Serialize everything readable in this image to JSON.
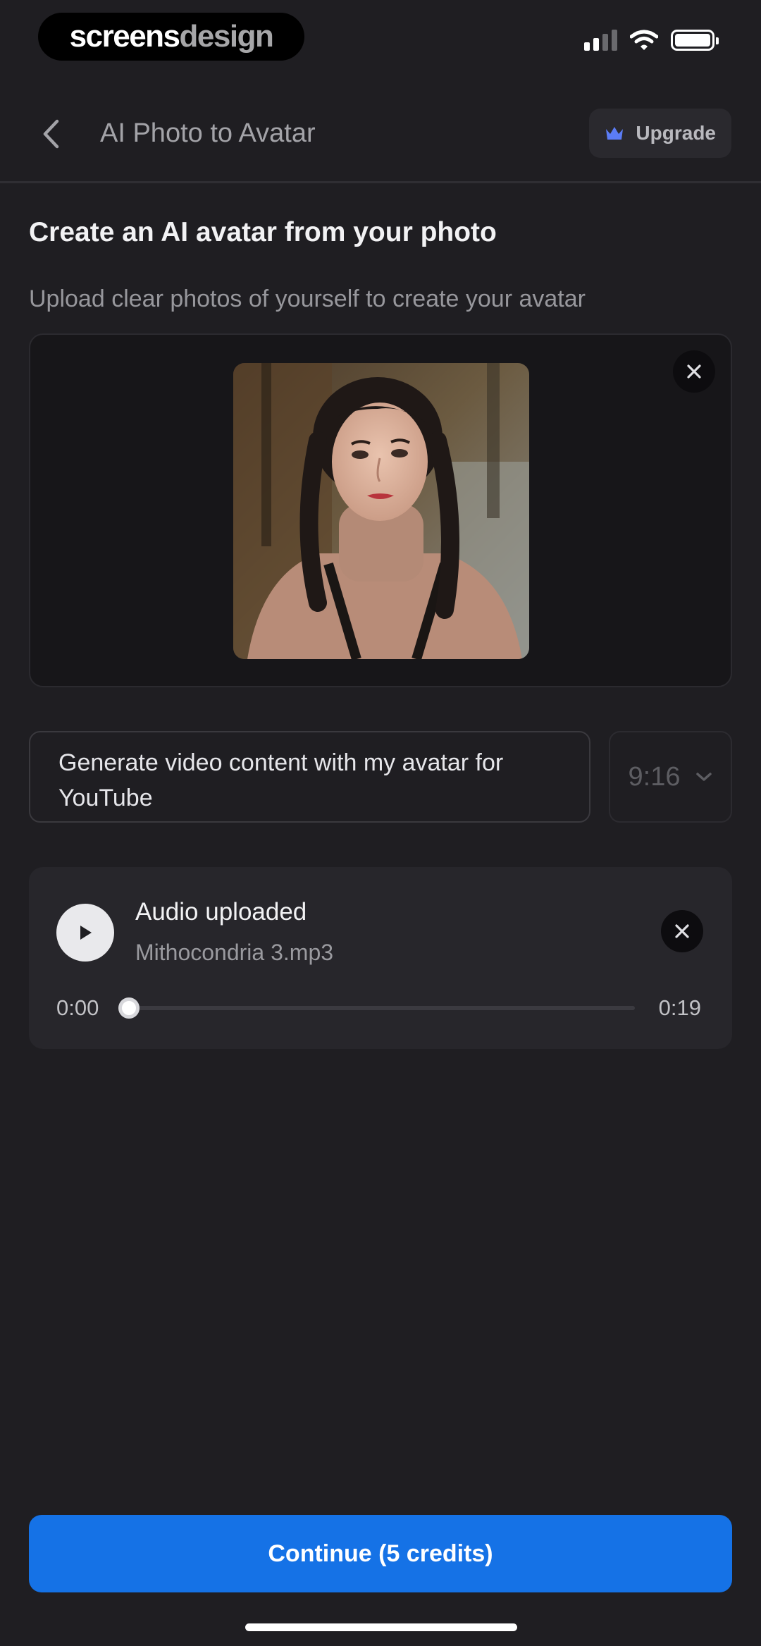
{
  "status_bar": {
    "brand_part1": "screens",
    "brand_part2": "design",
    "signal_icon": "cellular-signal-icon",
    "wifi_icon": "wifi-icon",
    "battery_icon": "battery-icon"
  },
  "header": {
    "back_icon": "chevron-left-icon",
    "title": "AI Photo to Avatar",
    "upgrade_label": "Upgrade",
    "upgrade_icon": "crown-icon",
    "upgrade_icon_color": "#5b7cf5"
  },
  "main": {
    "heading": "Create an AI avatar from your photo",
    "subtext": "Upload clear photos of yourself to create your avatar",
    "photo": {
      "description_icon": "uploaded-portrait-photo",
      "remove_icon": "close-icon"
    },
    "prompt_text": "Generate video content with my avatar for YouTube",
    "aspect_ratio": {
      "selected": "9:16",
      "icon": "chevron-down-icon"
    }
  },
  "audio": {
    "title": "Audio uploaded",
    "filename": "Mithocondria 3.mp3",
    "current_time": "0:00",
    "duration": "0:19",
    "progress": 0,
    "play_icon": "play-icon",
    "remove_icon": "close-icon"
  },
  "footer": {
    "continue_label": "Continue (5 credits)",
    "accent_color": "#1572e6"
  }
}
